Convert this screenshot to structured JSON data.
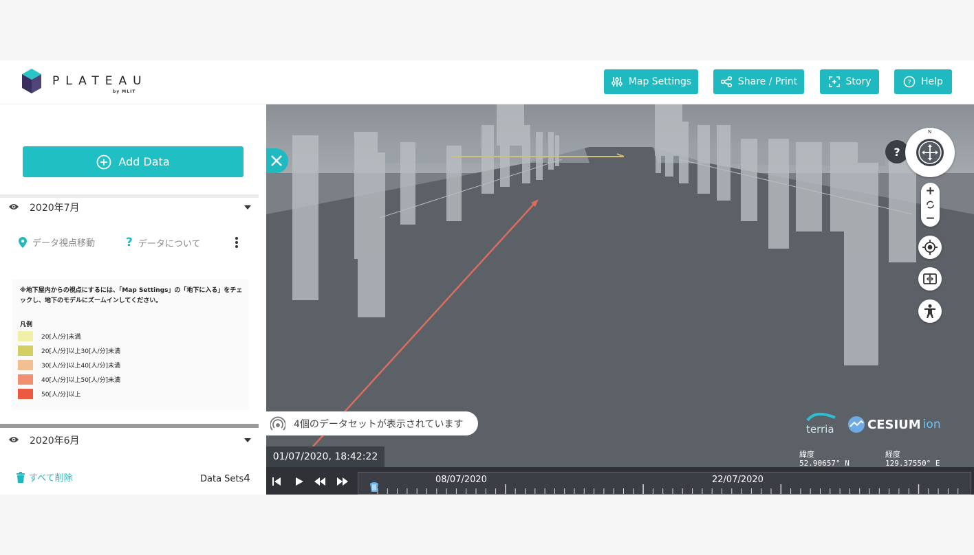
{
  "header": {
    "logo_text": "PLATEAU",
    "logo_sub": "by MLIT",
    "buttons": [
      {
        "label": "Map Settings",
        "icon": "sliders-icon"
      },
      {
        "label": "Share / Print",
        "icon": "share-icon"
      },
      {
        "label": "Story",
        "icon": "story-icon"
      },
      {
        "label": "Help",
        "icon": "help-icon"
      }
    ]
  },
  "sidebar": {
    "add_data_label": "Add Data",
    "workbench": [
      {
        "title": "2020年7月",
        "actions": {
          "zoom_label": "データ視点移動",
          "about_label": "データについて"
        },
        "legend": {
          "note": "※地下屋内からの視点にするには、「Map Settings」の「地下に入る」をチェックし、地下のモデルにズームインしてください。",
          "title": "凡例",
          "items": [
            {
              "label": "20[人/分]未満",
              "color": "#f0f0a8"
            },
            {
              "label": "20[人/分]以上30[人/分]未満",
              "color": "#d2cf62"
            },
            {
              "label": "30[人/分]以上40[人/分]未満",
              "color": "#f2be94"
            },
            {
              "label": "40[人/分]以上50[人/分]未満",
              "color": "#ef8f70"
            },
            {
              "label": "50[人/分]以上",
              "color": "#ea5a43"
            }
          ]
        }
      },
      {
        "title": "2020年6月"
      }
    ],
    "clear_all_label": "すべて削除",
    "data_sets_label": "Data Sets",
    "data_sets_count": "4"
  },
  "map": {
    "datasets_message": "4個のデータセットが表示されています",
    "datetime": "01/07/2020, 18:42:22",
    "coords": {
      "lat_label": "緯度",
      "lat_value": "52.90657° N",
      "lon_label": "経度",
      "lon_value": "129.37550° E"
    },
    "timeline": {
      "labels": [
        "08/07/2020",
        "22/07/2020"
      ]
    },
    "compass_north": "N",
    "help_glyph": "?",
    "brand_terria": "terria",
    "brand_cesium": "CESIUM",
    "brand_ion": "ion"
  },
  "colors": {
    "accent": "#1fb9bf",
    "map_bg": "#5c6168"
  }
}
